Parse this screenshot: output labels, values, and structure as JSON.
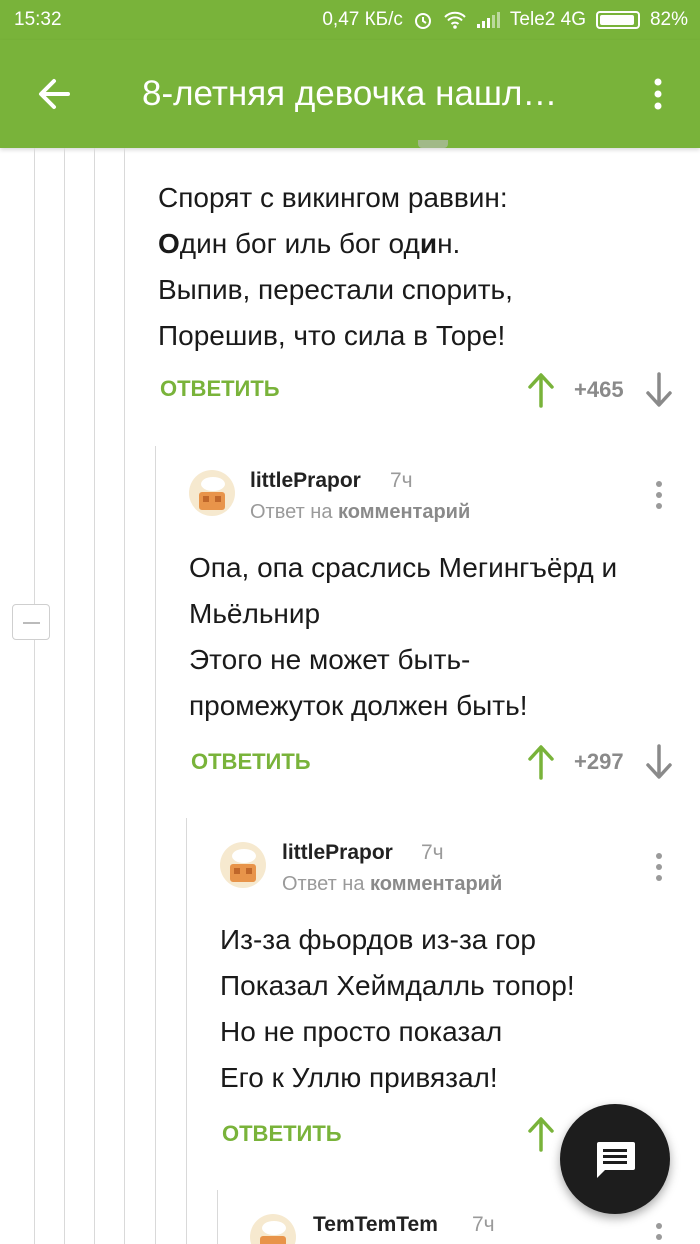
{
  "status": {
    "time": "15:32",
    "speed": "0,47 КБ/с",
    "carrier": "Tele2 4G",
    "battery": "82%"
  },
  "appbar": {
    "title": "8-летняя девочка нашл…"
  },
  "c1": {
    "lines": [
      "Спорят с викингом раввин:",
      "Один бог иль бог один.",
      "Выпив, перестали спорить,",
      "Порешив, что сила в Торе!"
    ],
    "l2": {
      "a": "О",
      "b": "дин бог иль бог од",
      "c": "и",
      "d": "н."
    },
    "reply": "ОТВЕТИТЬ",
    "score": "+465"
  },
  "c2": {
    "author": "littlePrapor",
    "time": "7ч",
    "reply_prefix": "Ответ на",
    "reply_link": "комментарий",
    "lines": [
      "Опа, опа сраслись Мегингъёрд и",
      "Мьёльнир",
      "Этого не может быть-",
      "промежуток должен быть!"
    ],
    "reply": "ОТВЕТИТЬ",
    "score": "+297"
  },
  "c3": {
    "author": "littlePrapor",
    "time": "7ч",
    "reply_prefix": "Ответ на",
    "reply_link": "комментарий",
    "lines": [
      "Из-за фьордов из-за гор",
      "Показал Хеймдалль топор!",
      "Но не просто показал",
      "Его к Уллю привязал!"
    ],
    "reply": "ОТВЕТИТЬ"
  },
  "c4": {
    "author": "TemTemTem",
    "time": "7ч"
  },
  "icons": {
    "back": "arrow-left-icon",
    "more": "more-vert-icon",
    "up": "upvote-icon",
    "down": "downvote-icon",
    "fab": "chat-icon"
  },
  "colors": {
    "brand": "#79b33a",
    "fab": "#1d1d1d"
  }
}
